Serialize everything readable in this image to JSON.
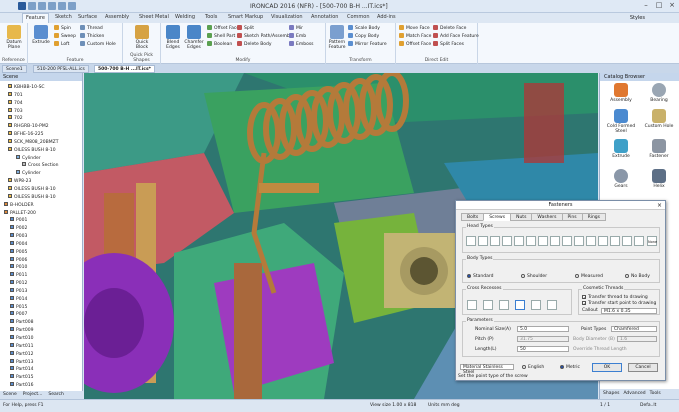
{
  "window": {
    "title": "IRONCAD 2016 (NFR) - [500-700 B-H ...IT.ics*]",
    "controls": [
      "–",
      "□",
      "×"
    ],
    "styles_label": "Styles"
  },
  "ribbon_tabs": [
    "Feature",
    "Sketch",
    "Surface",
    "Assembly",
    "Sheet Metal",
    "Welding",
    "Tools",
    "Smart Markup",
    "Visualization",
    "Annotation",
    "Common",
    "Add-ins"
  ],
  "ribbon": {
    "groups": [
      {
        "label": "Reference",
        "big": [
          "Datum Plane"
        ],
        "small": []
      },
      {
        "label": "Feature",
        "big": [
          "Extrude"
        ],
        "small": [
          "Spin",
          "Sweep",
          "Loft",
          "Thread",
          "Thicken",
          "Custom Hole"
        ]
      },
      {
        "label": "Quick Pick Shapes",
        "big": [
          "Quick Block"
        ],
        "small": []
      },
      {
        "label": "Modify",
        "big": [
          "Blend Edges",
          "Chamfer Edges"
        ],
        "small": [
          "Shell Part",
          "Boolean",
          "Offset Faces",
          "Split",
          "Sketch Path/Assembly",
          "Delete Body",
          "Mir",
          "Emb",
          "Emboss"
        ]
      },
      {
        "label": "Transform",
        "big": [
          "Pattern Feature"
        ],
        "small": [
          "Scale Body",
          "Copy Body",
          "Mirror Feature"
        ]
      },
      {
        "label": "Direct Edit",
        "big": [],
        "small": [
          "Move Face",
          "Match Face",
          "Offset Face",
          "Delete Face",
          "Add Face Feature",
          "Split Faces"
        ]
      }
    ]
  },
  "doc_tabs": [
    "Scene1",
    "510-200 PFSL-ALL.ics",
    "500-700 B-H ...IT.ics*"
  ],
  "scene_browser": {
    "title": "Scene",
    "items": [
      "KBHBB-10-SC",
      "701",
      "704",
      "703",
      "702",
      "RHGRB-10-PM2",
      "BFHE-16-225",
      "SCK_M808_20BMZT",
      "OILESS BUSH 8-10",
      "Cylinder",
      "Cross Section",
      "Cylinder",
      "WP8-23",
      "OILESS BUSH 8-10",
      "OILESS BUSH 8-10",
      "B-HOLDER",
      "PALLET-200",
      "P001",
      "P002",
      "P003",
      "P004",
      "P005",
      "P006",
      "P010",
      "P011",
      "P012",
      "P013",
      "P014",
      "P015",
      "P007",
      "Part008",
      "Part009",
      "Part010",
      "Part011",
      "Part012",
      "Part013",
      "Part014",
      "Part015",
      "Part016",
      "Part017"
    ],
    "bottom_tabs": [
      "Scene",
      "Project...",
      "Search"
    ]
  },
  "catalog": {
    "title": "Catalog Browser",
    "items": [
      "Assembly",
      "Bearing",
      "Cold Formed Steel",
      "Custom Hole",
      "Extrude",
      "Fastener",
      "Gears",
      "Helix"
    ],
    "bottom_tabs": [
      "Shapes",
      "Advanced",
      "Tools"
    ]
  },
  "fasteners_dialog": {
    "title": "Fasteners",
    "close": "×",
    "tabs": [
      "Bolts",
      "Screws",
      "Nuts",
      "Washers",
      "Pins",
      "Rings"
    ],
    "active_tab": "Screws",
    "head_types_label": "Head Types",
    "head_type_none": "None",
    "body_types_label": "Body Types",
    "body_types": [
      "Standard",
      "Shoulder",
      "Measured",
      "No Body"
    ],
    "cross_recesses_label": "Cross Recesses",
    "cosmetic_threads_label": "Cosmetic Threads",
    "cosmetic_checks": [
      "Transfer thread to drawing",
      "Transfer start point to drawing"
    ],
    "callout_label": "Callout",
    "callout_value": "M1.6 x 0.35",
    "parameters_label": "Parameters",
    "params": {
      "nominal_label": "Nominal Size(A)",
      "nominal_value": "5.0",
      "pitch_label": "Pitch (P)",
      "pitch_value": "31.75",
      "length_label": "Length(L)",
      "length_value": "50",
      "point_types_label": "Point Types",
      "point_types_value": "Chamfered",
      "body_diameter_label": "Body Diameter (B)",
      "body_diameter_value": "1.6",
      "override_label": "Override Thread Length"
    },
    "material_value": "Material Stainless Steel",
    "unit_options": [
      "English",
      "Metric"
    ],
    "ok_label": "OK",
    "cancel_label": "Cancel",
    "status_hint": "Set the point type of the screw"
  },
  "status_bar": {
    "left": "For Help, press F1",
    "view_size": "View size 1.00 x 818",
    "units": "Units mm deg",
    "page": "1 / 1",
    "zoom": "Defa..lt"
  },
  "colors": {
    "accent": "#2b5797",
    "title_bg": "#dfe9f5",
    "ribbon_bg": "#f4f8fd"
  }
}
